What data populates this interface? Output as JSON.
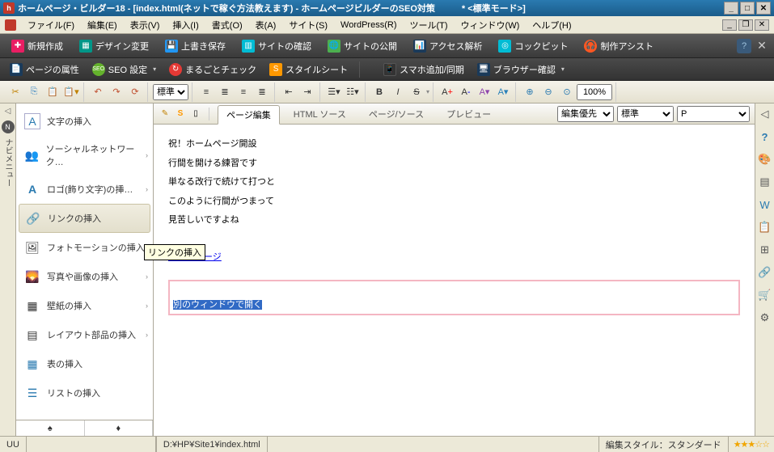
{
  "app": {
    "title": "ホームページ・ビルダー18 - [index.html(ネットで稼ぐ方法教えます) - ホームページビルダーのSEO対策　　　* <標準モード>]"
  },
  "menu": {
    "file": "ファイル(F)",
    "edit": "編集(E)",
    "view": "表示(V)",
    "insert": "挿入(I)",
    "format": "書式(O)",
    "table": "表(A)",
    "site": "サイト(S)",
    "wordpress": "WordPress(R)",
    "tools": "ツール(T)",
    "window": "ウィンドウ(W)",
    "help": "ヘルプ(H)"
  },
  "ribbon": {
    "new": "新規作成",
    "design_change": "デザイン変更",
    "save_overwrite": "上書き保存",
    "site_confirm": "サイトの確認",
    "site_publish": "サイトの公開",
    "access_analysis": "アクセス解析",
    "cockpit": "コックピット",
    "creation_assist": "制作アシスト"
  },
  "ribbon2": {
    "page_props": "ページの属性",
    "seo_settings": "SEO 設定",
    "whole_check": "まるごとチェック",
    "stylesheet": "スタイルシート",
    "smartphone_sync": "スマホ追加/同期",
    "browser_confirm": "ブラウザー確認"
  },
  "fmt": {
    "style": "標準",
    "zoom": "100%"
  },
  "sidebar": {
    "items": [
      {
        "label": "文字の挿入"
      },
      {
        "label": "ソーシャルネットワーク…"
      },
      {
        "label": "ロゴ(飾り文字)の挿…"
      },
      {
        "label": "リンクの挿入"
      },
      {
        "label": "フォトモーションの挿入"
      },
      {
        "label": "写真や画像の挿入"
      },
      {
        "label": "壁紙の挿入"
      },
      {
        "label": "レイアウト部品の挿入"
      },
      {
        "label": "表の挿入"
      },
      {
        "label": "リストの挿入"
      }
    ],
    "vtext": "ナビメニュー"
  },
  "tooltip": "リンクの挿入",
  "tabs": {
    "page_edit": "ページ編集",
    "html_source": "HTML ソース",
    "page_source": "ページ/ソース",
    "preview": "プレビュー"
  },
  "tab_right": {
    "edit_priority": "編集優先",
    "standard": "標準",
    "p": "P"
  },
  "doc": {
    "l1": "祝！ホームページ開設",
    "l2": "行間を開ける練習です",
    "l3": "単なる改行で続けて打つと",
    "l4": "このように行間がつまって",
    "l5": "見苦しいですよね",
    "link": "最初のページ",
    "selected": "別のウィンドウで開く"
  },
  "status": {
    "uu": "UU",
    "path": "D:¥HP¥Site1¥index.html",
    "edit_style": "編集スタイル：スタンダード",
    "stars": "★★★☆☆"
  }
}
